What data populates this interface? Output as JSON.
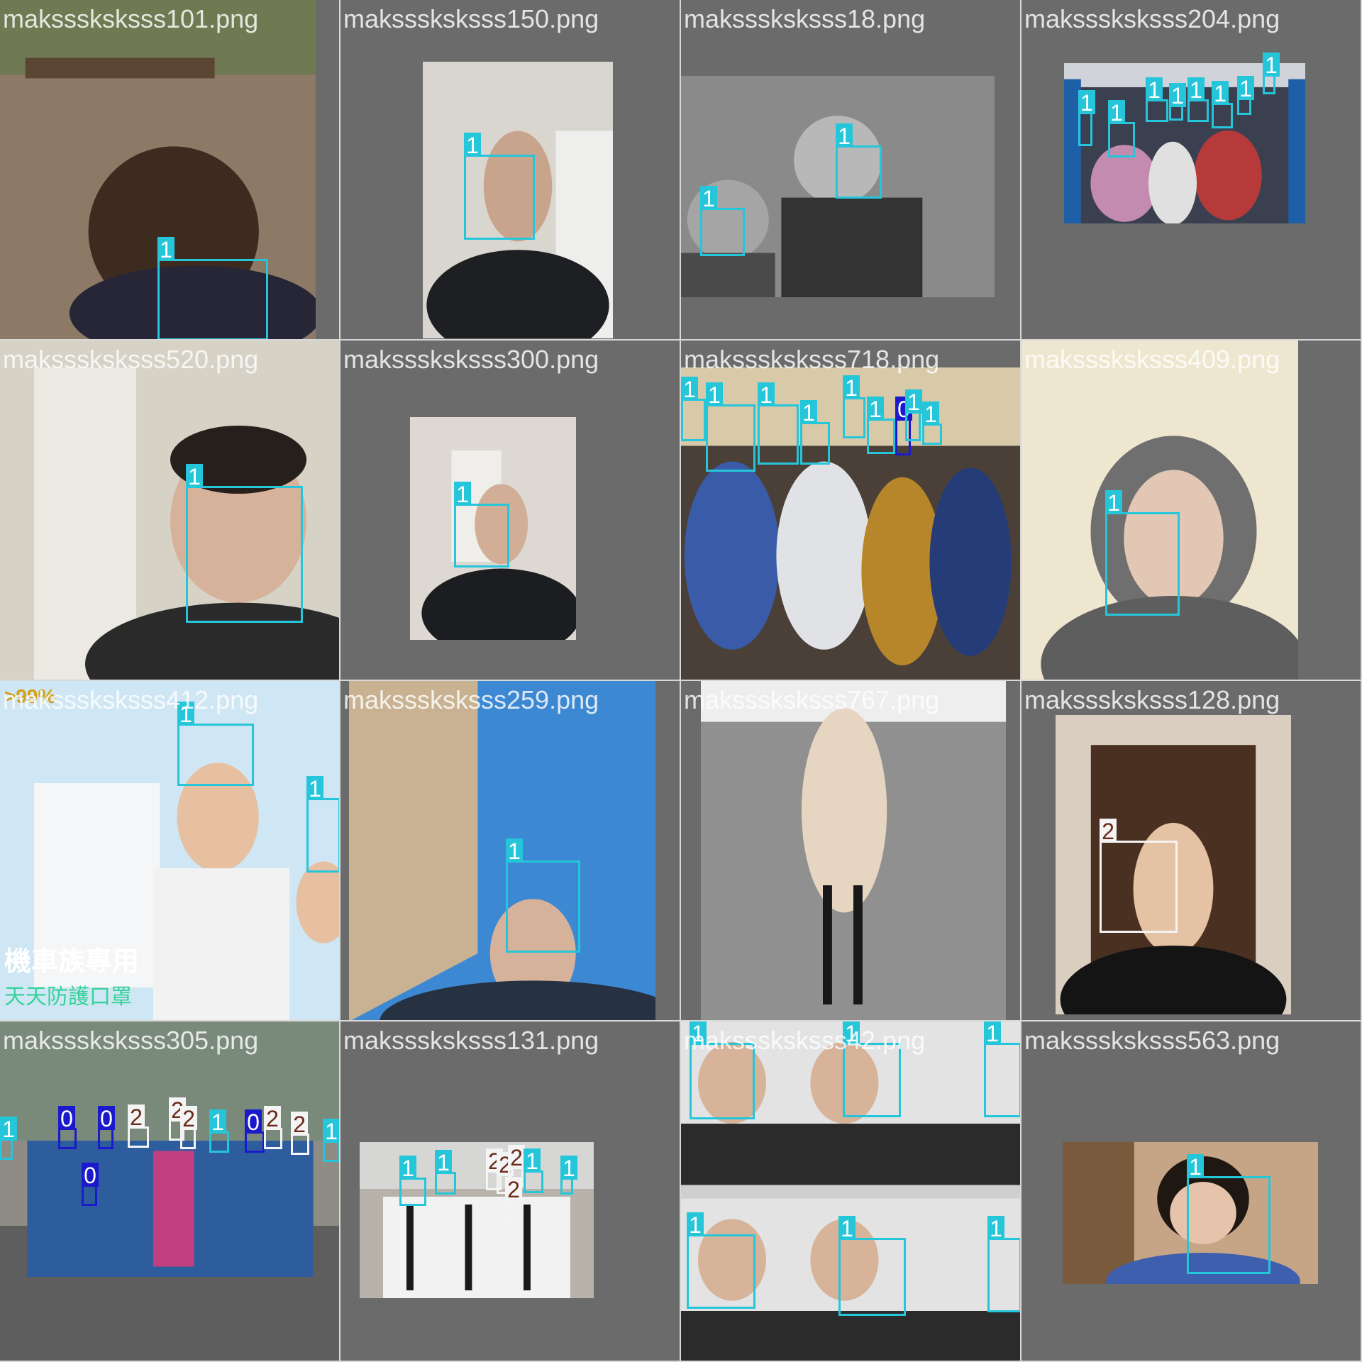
{
  "colors": {
    "background": "#6b6b6b",
    "class_0": "#1a1acc",
    "class_1": "#26c6da",
    "class_2": "#f4f4f4",
    "label_text_class_2": "#6a2a1a"
  },
  "tiles": [
    {
      "filename": "maksssksksss101.png",
      "scene": "selftie-garden",
      "labels": [
        "1"
      ]
    },
    {
      "filename": "maksssksksss150.png",
      "scene": "selfie-room",
      "labels": [
        "1"
      ]
    },
    {
      "filename": "maksssksksss18.png",
      "scene": "grayscale-street",
      "labels": [
        "1",
        "1"
      ]
    },
    {
      "filename": "maksssksksss204.png",
      "scene": "subway-crowd",
      "labels": [
        "1",
        "1",
        "1",
        "1",
        "1",
        "1",
        "1",
        "1"
      ]
    },
    {
      "filename": "maksssksksss520.png",
      "scene": "selfie-door",
      "labels": [
        "1"
      ]
    },
    {
      "filename": "maksssksksss300.png",
      "scene": "selfie-room",
      "labels": [
        "1"
      ]
    },
    {
      "filename": "maksssksksss718.png",
      "scene": "seated-elders",
      "labels": [
        "1",
        "1",
        "1",
        "1",
        "1",
        "1",
        "0",
        "1",
        "1"
      ]
    },
    {
      "filename": "maksssksksss409.png",
      "scene": "hoodie-selfie",
      "labels": [
        "1"
      ]
    },
    {
      "filename": "maksssksksss412.png",
      "scene": "mask-advert",
      "labels": [
        "1",
        "1"
      ],
      "overlay_text": {
        "percent": ">99%",
        "slogan": "機車族專用",
        "product": "天天防護口罩"
      }
    },
    {
      "filename": "maksssksksss259.png",
      "scene": "low-angle-building",
      "labels": [
        "1"
      ]
    },
    {
      "filename": "maksssksksss767.png",
      "scene": "runway",
      "labels": []
    },
    {
      "filename": "maksssksksss128.png",
      "scene": "selfie-doorway",
      "labels": [
        "2"
      ]
    },
    {
      "filename": "maksssksksss305.png",
      "scene": "temple-group",
      "labels": [
        "1",
        "0",
        "0",
        "2",
        "2",
        "2",
        "1",
        "0",
        "2",
        "2",
        "1",
        "0"
      ]
    },
    {
      "filename": "maksssksksss131.png",
      "scene": "students-walking",
      "labels": [
        "1",
        "1",
        "2",
        "2",
        "2",
        "1",
        "1",
        "2"
      ]
    },
    {
      "filename": "maksssksksss42.png",
      "scene": "mask-product-grid",
      "labels": [
        "1",
        "1",
        "1",
        "1",
        "1",
        "1"
      ]
    },
    {
      "filename": "maksssksksss563.png",
      "scene": "girl-n95",
      "labels": [
        "1"
      ]
    }
  ]
}
